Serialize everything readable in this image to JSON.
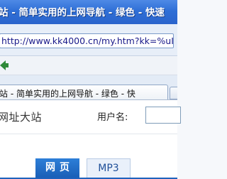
{
  "window": {
    "title": "站 - 简单实用的上网导航 - 绿色 - 快速"
  },
  "address_bar": {
    "url": "http://www.kk4000.cn/my.htm?kk=%uI"
  },
  "tab": {
    "label": "站 - 简单实用的上网导航 - 绿色 - 快"
  },
  "page": {
    "site_name": "网址大站",
    "username_label": "用户名:",
    "search_tabs": [
      "网页",
      "MP3"
    ]
  },
  "colors": {
    "titlebar": "#2f6fd6",
    "accent": "#1f62bd"
  }
}
